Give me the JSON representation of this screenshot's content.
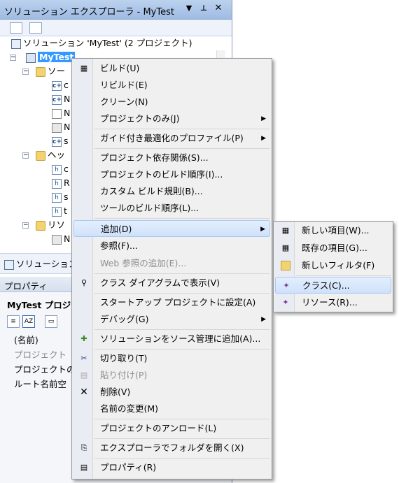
{
  "solution_explorer": {
    "title": "ソリューション エクスプローラ - MyTest",
    "title_buttons": [
      "▼",
      "⊥",
      "✕"
    ],
    "root": "ソリューション 'MyTest' (2 プロジェクト)",
    "project": "MyTest",
    "nodes": [
      {
        "label": "ソー",
        "icon": "folder-icon"
      },
      {
        "label": "c",
        "icon": "cpp-file-icon"
      },
      {
        "label": "N",
        "icon": "cpp-file-icon"
      },
      {
        "label": "N",
        "icon": "text-file-icon"
      },
      {
        "label": "N",
        "icon": "resource-file-icon"
      },
      {
        "label": "s",
        "icon": "cpp-file-icon"
      },
      {
        "label": "ヘッ",
        "icon": "folder-icon"
      },
      {
        "label": "c",
        "icon": "header-file-icon"
      },
      {
        "label": "R",
        "icon": "header-file-icon"
      },
      {
        "label": "s",
        "icon": "header-file-icon"
      },
      {
        "label": "t",
        "icon": "header-file-icon"
      },
      {
        "label": "リソ",
        "icon": "folder-icon"
      },
      {
        "label": "N",
        "icon": "resource-file-icon"
      }
    ],
    "bottom_tab": "ソリューション"
  },
  "properties": {
    "title": "プロパティ",
    "object": "MyTest プロジェ",
    "rows": [
      "(名前)",
      "プロジェクト",
      "プロジェクトの",
      "ルート名前空"
    ]
  },
  "context_menu": {
    "items": [
      {
        "label": "ビルド(U)",
        "icon": "build-icon"
      },
      {
        "label": "リビルド(E)"
      },
      {
        "label": "クリーン(N)"
      },
      {
        "label": "プロジェクトのみ(J)",
        "submenu": true
      },
      {
        "sep": true
      },
      {
        "label": "ガイド付き最適化のプロファイル(P)",
        "submenu": true
      },
      {
        "sep": true
      },
      {
        "label": "プロジェクト依存関係(S)..."
      },
      {
        "label": "プロジェクトのビルド順序(I)..."
      },
      {
        "label": "カスタム ビルド規則(B)..."
      },
      {
        "label": "ツールのビルド順序(L)..."
      },
      {
        "sep": true
      },
      {
        "label": "追加(D)",
        "submenu": true,
        "highlighted": true
      },
      {
        "label": "参照(F)..."
      },
      {
        "label": "Web 参照の追加(E)...",
        "disabled": true
      },
      {
        "sep": true
      },
      {
        "label": "クラス ダイアグラムで表示(V)",
        "icon": "class-diagram-icon"
      },
      {
        "sep": true
      },
      {
        "label": "スタートアップ プロジェクトに設定(A)"
      },
      {
        "label": "デバッグ(G)",
        "submenu": true
      },
      {
        "sep": true
      },
      {
        "label": "ソリューションをソース管理に追加(A)...",
        "icon": "source-control-icon"
      },
      {
        "sep": true
      },
      {
        "label": "切り取り(T)",
        "icon": "cut-icon"
      },
      {
        "label": "貼り付け(P)",
        "icon": "paste-icon",
        "disabled": true
      },
      {
        "label": "削除(V)",
        "icon": "delete-icon"
      },
      {
        "label": "名前の変更(M)"
      },
      {
        "sep": true
      },
      {
        "label": "プロジェクトのアンロード(L)"
      },
      {
        "sep": true
      },
      {
        "label": "エクスプローラでフォルダを開く(X)",
        "icon": "open-folder-icon"
      },
      {
        "sep": true
      },
      {
        "label": "プロパティ(R)",
        "icon": "properties-icon"
      }
    ]
  },
  "submenu": {
    "items": [
      {
        "label": "新しい項目(W)...",
        "icon": "new-item-icon"
      },
      {
        "label": "既存の項目(G)...",
        "icon": "existing-item-icon"
      },
      {
        "label": "新しいフィルタ(F)",
        "icon": "new-filter-icon"
      },
      {
        "sep": true
      },
      {
        "label": "クラス(C)...",
        "icon": "class-icon",
        "highlighted": true
      },
      {
        "label": "リソース(R)...",
        "icon": "resource-icon"
      }
    ]
  }
}
